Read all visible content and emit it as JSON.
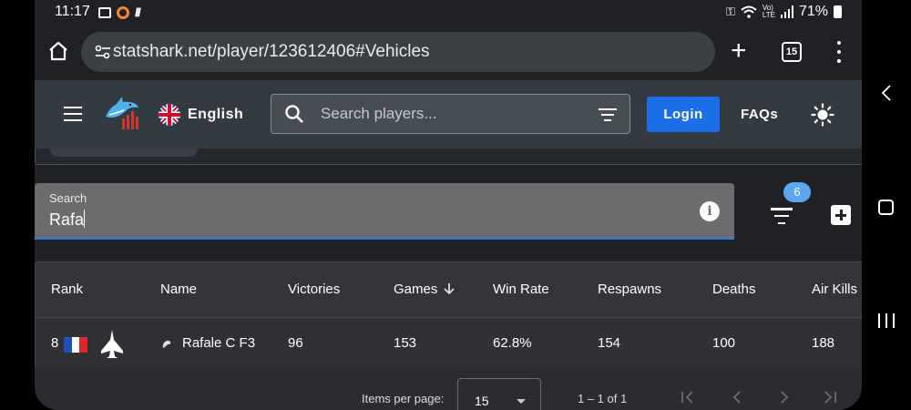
{
  "status_bar": {
    "time": "11:17",
    "battery": "71%"
  },
  "browser": {
    "url": "statshark.net/player/123612406#Vehicles",
    "tab_count": "15"
  },
  "header": {
    "language": "English",
    "search_placeholder": "Search players...",
    "login_label": "Login",
    "faqs_label": "FAQs"
  },
  "search_field": {
    "label": "Search",
    "value": "Rafa"
  },
  "filters": {
    "badge_count": "6"
  },
  "table": {
    "columns": [
      "Rank",
      "Name",
      "Victories",
      "Games",
      "Win Rate",
      "Respawns",
      "Deaths",
      "Air Kills"
    ],
    "rows": [
      {
        "rank": "8",
        "name": "Rafale C F3",
        "victories": "96",
        "games": "153",
        "win_rate": "62.8%",
        "respawns": "154",
        "deaths": "100",
        "air_kills": "188"
      }
    ]
  },
  "paginator": {
    "items_per_page_label": "Items per page:",
    "items_per_page": "15",
    "range": "1 – 1 of 1"
  },
  "colors": {
    "accent": "#1a6fe8",
    "badge": "#5aa7f0",
    "header_bg": "#333a42"
  }
}
